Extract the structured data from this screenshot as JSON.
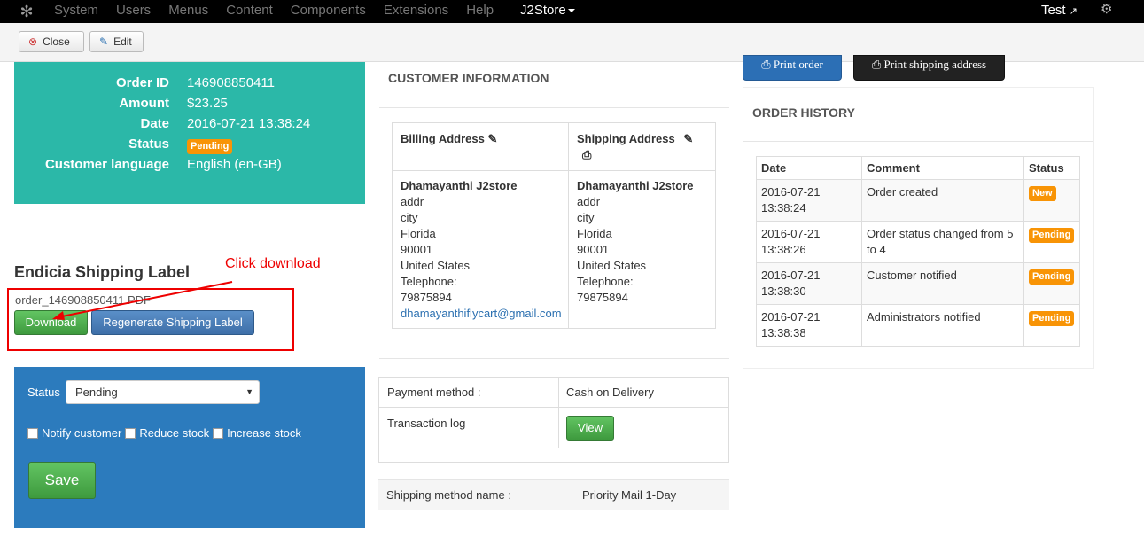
{
  "nav": {
    "menu": [
      "System",
      "Users",
      "Menus",
      "Content",
      "Components",
      "Extensions",
      "Help"
    ],
    "j2store": "J2Store",
    "user": "Test"
  },
  "toolbar": {
    "close_label": "Close",
    "edit_label": "Edit"
  },
  "summary": {
    "order_id_label": "Order ID",
    "order_id": "146908850411",
    "amount_label": "Amount",
    "amount": "$23.25",
    "date_label": "Date",
    "date": "2016-07-21 13:38:24",
    "status_label": "Status",
    "status": "Pending",
    "lang_label": "Customer language",
    "lang": "English (en-GB)"
  },
  "endicia": {
    "title": "Endicia Shipping Label",
    "annotation": "Click download",
    "filename": "order_146908850411.PDF",
    "download_label": "Download",
    "regenerate_label": "Regenerate Shipping Label"
  },
  "status_form": {
    "status_label": "Status",
    "status_value": "Pending",
    "notify_label": "Notify customer",
    "reduce_label": "Reduce stock",
    "increase_label": "Increase stock",
    "save_label": "Save"
  },
  "customer": {
    "title": "CUSTOMER INFORMATION",
    "billing_header": "Billing Address",
    "shipping_header": "Shipping Address",
    "billing": {
      "name": "Dhamayanthi J2store",
      "addr": "addr",
      "city": "city",
      "state": "Florida",
      "zip": "90001",
      "country": "United States",
      "tel_label": "Telephone:",
      "tel": "79875894",
      "email": "dhamayanthiflycart@gmail.com"
    },
    "shipping": {
      "name": "Dhamayanthi J2store",
      "addr": "addr",
      "city": "city",
      "state": "Florida",
      "zip": "90001",
      "country": "United States",
      "tel_label": "Telephone:",
      "tel": "79875894"
    }
  },
  "payment": {
    "method_label": "Payment method :",
    "method": "Cash on Delivery",
    "log_label": "Transaction log",
    "view_label": "View"
  },
  "shipping_method": {
    "label": "Shipping method name :",
    "value": "Priority Mail 1-Day"
  },
  "print": {
    "order_label": "Print order",
    "shipping_label": "Print shipping address"
  },
  "history": {
    "title": "ORDER HISTORY",
    "headers": [
      "Date",
      "Comment",
      "Status"
    ],
    "rows": [
      {
        "date": "2016-07-21 13:38:24",
        "comment": "Order created",
        "status": "New"
      },
      {
        "date": "2016-07-21 13:38:26",
        "comment": "Order status changed from 5 to 4",
        "status": "Pending"
      },
      {
        "date": "2016-07-21 13:38:30",
        "comment": "Customer notified",
        "status": "Pending"
      },
      {
        "date": "2016-07-21 13:38:38",
        "comment": "Administrators notified",
        "status": "Pending"
      }
    ]
  },
  "colors": {
    "teal": "#2bb8a8",
    "blue": "#2c7bbd",
    "badge": "#f89406",
    "annotation": "#ee0000"
  }
}
